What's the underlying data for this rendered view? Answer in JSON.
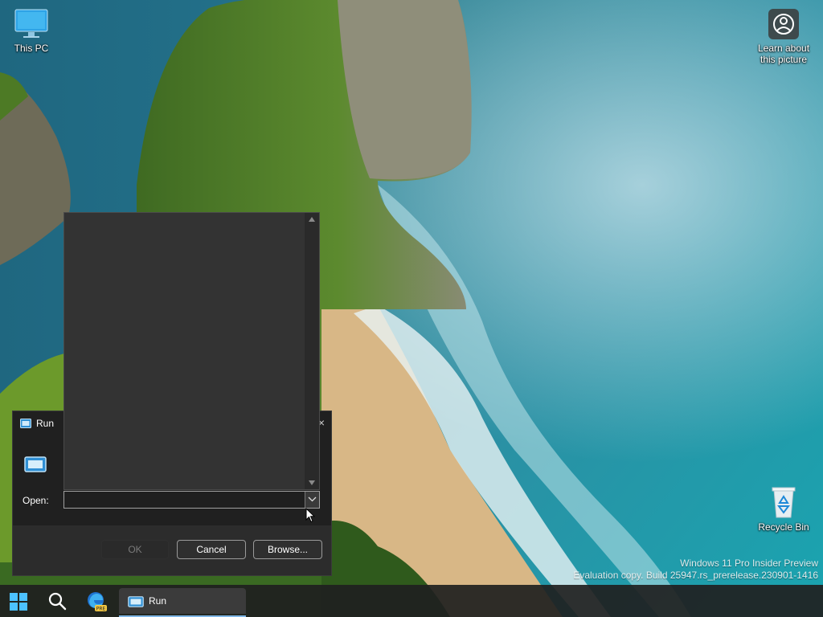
{
  "desktop": {
    "icons": [
      {
        "label": "This PC"
      },
      {
        "label": "Learn about this picture"
      },
      {
        "label": "Recycle Bin"
      }
    ],
    "watermark": {
      "line1": "Windows 11 Pro Insider Preview",
      "line2": "Evaluation copy. Build 25947.rs_prerelease.230901-1416"
    }
  },
  "run_dialog": {
    "title": "Run",
    "close_glyph": "×",
    "open_label": "Open:",
    "open_value": "",
    "buttons": {
      "ok": "OK",
      "cancel": "Cancel",
      "browse": "Browse..."
    }
  },
  "taskbar": {
    "items": [
      {
        "icon": "windows-start-icon"
      },
      {
        "icon": "search-icon"
      },
      {
        "icon": "edge-canary-icon"
      },
      {
        "icon": "run-icon",
        "label": "Run"
      }
    ]
  },
  "colors": {
    "dialog_bg": "#202020",
    "footer_bg": "#2c2c2c",
    "dropdown_bg": "#333333",
    "taskbar_bg": "#202020",
    "accent": "#7fb6e6"
  }
}
